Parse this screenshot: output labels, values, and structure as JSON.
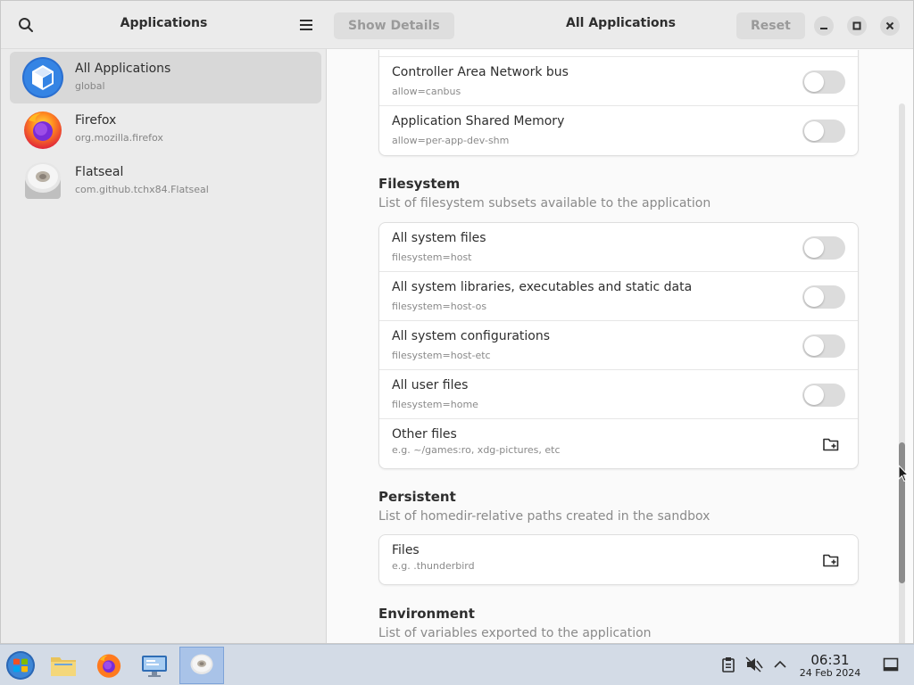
{
  "left_panel": {
    "title": "Applications",
    "apps": [
      {
        "name": "All Applications",
        "id": "global"
      },
      {
        "name": "Firefox",
        "id": "org.mozilla.firefox"
      },
      {
        "name": "Flatseal",
        "id": "com.github.tchx84.Flatseal"
      }
    ]
  },
  "header": {
    "show_details": "Show Details",
    "title": "All Applications",
    "reset": "Reset"
  },
  "devices_card": {
    "rows": [
      {
        "title": "Controller Area Network bus",
        "sub": "allow=canbus",
        "enabled": false
      },
      {
        "title": "Application Shared Memory",
        "sub": "allow=per-app-dev-shm",
        "enabled": false
      }
    ]
  },
  "filesystem": {
    "title": "Filesystem",
    "subtitle": "List of filesystem subsets available to the application",
    "rows": [
      {
        "title": "All system files",
        "sub": "filesystem=host",
        "enabled": false
      },
      {
        "title": "All system libraries, executables and static data",
        "sub": "filesystem=host-os",
        "enabled": false
      },
      {
        "title": "All system configurations",
        "sub": "filesystem=host-etc",
        "enabled": false
      },
      {
        "title": "All user files",
        "sub": "filesystem=home",
        "enabled": false
      }
    ],
    "other": {
      "title": "Other files",
      "sub": "e.g. ~/games:ro, xdg-pictures, etc"
    }
  },
  "persistent": {
    "title": "Persistent",
    "subtitle": "List of homedir-relative paths created in the sandbox",
    "files": {
      "title": "Files",
      "sub": "e.g. .thunderbird"
    }
  },
  "environment": {
    "title": "Environment",
    "subtitle": "List of variables exported to the application"
  },
  "taskbar": {
    "time": "06:31",
    "date": "24 Feb 2024"
  },
  "colors": {
    "accent": "#3584e4",
    "toggle_off": "#dcdcdc"
  }
}
